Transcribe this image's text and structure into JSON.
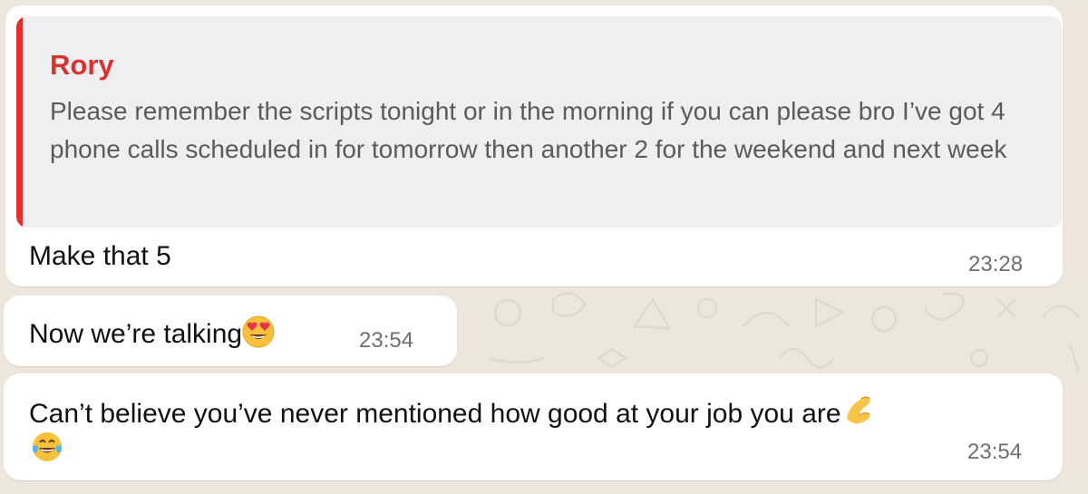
{
  "messages": [
    {
      "quoted": {
        "author": "Rory",
        "text": "Please remember the scripts tonight or in the morning if you can please bro I’ve got 4 phone calls scheduled in for tomorrow then another 2 for the weekend and next week"
      },
      "text": "Make that 5",
      "time": "23:28"
    },
    {
      "text": "Now we’re talking",
      "emoji": "heart-eyes-emoji",
      "time": "23:54"
    },
    {
      "text": "Can’t believe you’ve never mentioned how good at your job you are",
      "emoji": [
        "pinching-hand-emoji",
        "tears-of-joy-emoji"
      ],
      "time": "23:54"
    }
  ],
  "colors": {
    "quote_bar": "#e2312c",
    "quote_author": "#d8322d",
    "bubble": "#ffffff",
    "wallpaper": "#ede6dc"
  }
}
